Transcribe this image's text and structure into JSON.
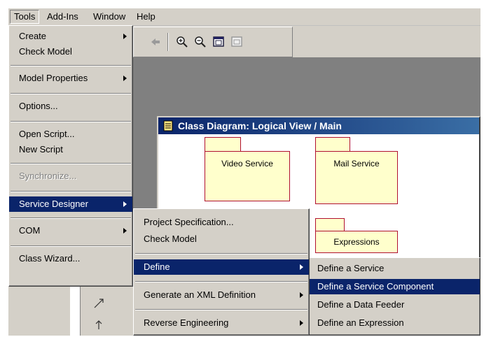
{
  "menubar": {
    "items": [
      "Tools",
      "Add-Ins",
      "Window",
      "Help"
    ]
  },
  "diagram": {
    "title": "Class Diagram: Logical View / Main",
    "packages": [
      "Video Service",
      "Mail Service",
      "Expressions"
    ]
  },
  "tools_menu": {
    "items": [
      "Create",
      "Check Model",
      "Model Properties",
      "Options...",
      "Open Script...",
      "New Script",
      "Synchronize...",
      "Service Designer",
      "COM",
      "Class Wizard..."
    ]
  },
  "service_designer_menu": {
    "items": [
      "Project Specification...",
      "Check Model",
      "Define",
      "Generate an XML Definition",
      "Reverse Engineering"
    ]
  },
  "define_menu": {
    "items": [
      "Define a Service",
      "Define a Service Component",
      "Define a Data Feeder",
      "Define an Expression"
    ]
  },
  "icons": [
    "back-arrow-icon",
    "zoom-in-icon",
    "zoom-out-icon",
    "fit-window-icon",
    "undo-fit-icon",
    "diagram-icon",
    "line-tool-icon",
    "anchor-tool-icon"
  ],
  "colors": {
    "highlight": "#0a246a",
    "package_fill": "#ffffcc",
    "package_border": "#b01030",
    "menu_bg": "#d4d0c8"
  }
}
